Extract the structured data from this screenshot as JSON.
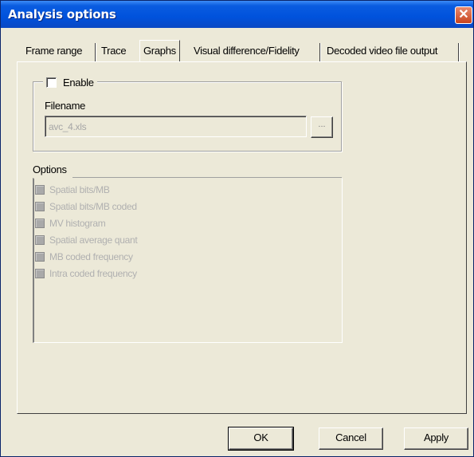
{
  "window": {
    "title": "Analysis options",
    "close_glyph": "✕"
  },
  "tabs": [
    {
      "label": "Frame range",
      "active": false
    },
    {
      "label": "Trace",
      "active": false
    },
    {
      "label": "Graphs",
      "active": true
    },
    {
      "label": "Visual difference/Fidelity",
      "active": false
    },
    {
      "label": "Decoded video file output",
      "active": false
    }
  ],
  "enable": {
    "label": "Enable",
    "checked": false
  },
  "filename": {
    "label": "Filename",
    "value": "avc_4.xls",
    "browse_label": "..."
  },
  "options": {
    "label": "Options",
    "items": [
      {
        "label": "Spatial bits/MB",
        "checked": false,
        "enabled": false
      },
      {
        "label": "Spatial bits/MB coded",
        "checked": false,
        "enabled": false
      },
      {
        "label": "MV histogram",
        "checked": false,
        "enabled": false
      },
      {
        "label": "Spatial average quant",
        "checked": false,
        "enabled": false
      },
      {
        "label": "MB coded frequency",
        "checked": false,
        "enabled": false
      },
      {
        "label": "Intra coded frequency",
        "checked": false,
        "enabled": false
      }
    ]
  },
  "buttons": {
    "ok": "OK",
    "cancel": "Cancel",
    "apply": "Apply"
  },
  "colors": {
    "titlebar": "#0052dc",
    "dialog_bg": "#ece9d8",
    "disabled_text": "#b0b0b0",
    "close_button": "#c8441e"
  }
}
